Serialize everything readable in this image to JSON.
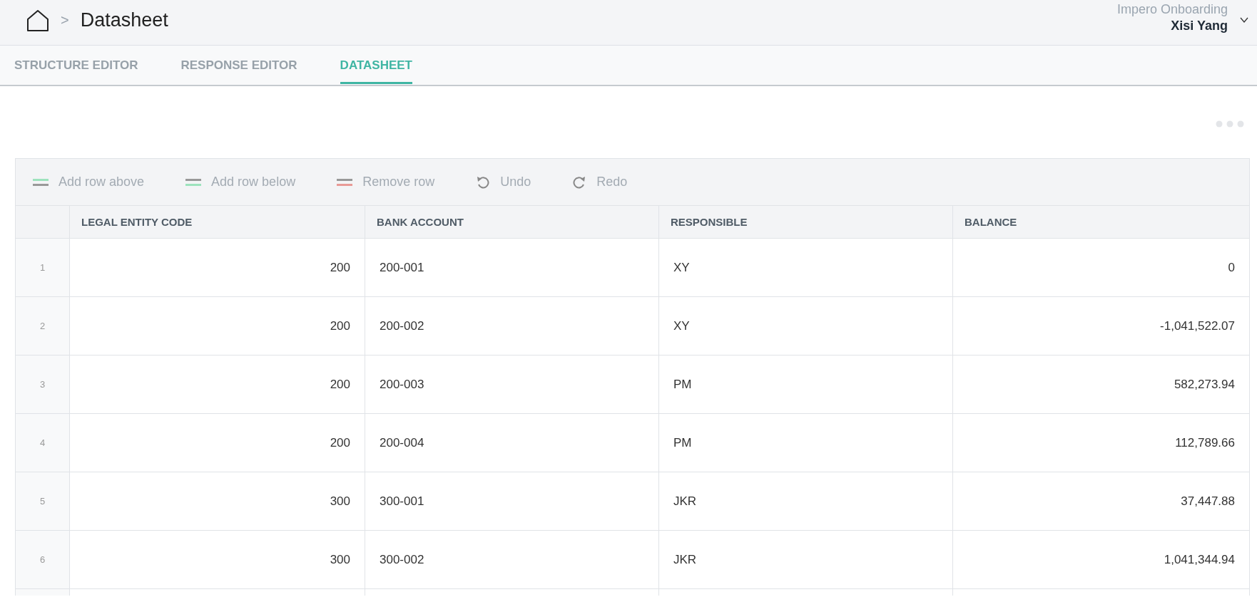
{
  "breadcrumb": {
    "separator": ">",
    "title": "Datasheet"
  },
  "account": {
    "organization": "Impero Onboarding",
    "user": "Xisi Yang"
  },
  "tabs": [
    {
      "label": "STRUCTURE EDITOR",
      "selected": false
    },
    {
      "label": "RESPONSE EDITOR",
      "selected": false
    },
    {
      "label": "DATASHEET",
      "selected": true
    }
  ],
  "toolbar": [
    {
      "kind": "add-above",
      "label": "Add row above",
      "disabled": true
    },
    {
      "kind": "add-below",
      "label": "Add row below",
      "disabled": true
    },
    {
      "kind": "remove",
      "label": "Remove row",
      "disabled": true
    },
    {
      "kind": "undo",
      "label": "Undo",
      "disabled": true
    },
    {
      "kind": "redo",
      "label": "Redo",
      "disabled": true
    }
  ],
  "table": {
    "columns": [
      {
        "label": "LEGAL ENTITY CODE",
        "kind": "number"
      },
      {
        "label": "BANK ACCOUNT",
        "kind": "text"
      },
      {
        "label": "RESPONSIBLE",
        "kind": "text"
      },
      {
        "label": "BALANCE",
        "kind": "number"
      }
    ],
    "rows": [
      {
        "number": "1",
        "cells": [
          "200",
          "200-001",
          "XY",
          "0"
        ]
      },
      {
        "number": "2",
        "cells": [
          "200",
          "200-002",
          "XY",
          "-1,041,522.07"
        ]
      },
      {
        "number": "3",
        "cells": [
          "200",
          "200-003",
          "PM",
          "582,273.94"
        ]
      },
      {
        "number": "4",
        "cells": [
          "200",
          "200-004",
          "PM",
          "112,789.66"
        ]
      },
      {
        "number": "5",
        "cells": [
          "300",
          "300-001",
          "JKR",
          "37,447.88"
        ]
      },
      {
        "number": "6",
        "cells": [
          "300",
          "300-002",
          "JKR",
          "1,041,344.94"
        ]
      }
    ]
  }
}
